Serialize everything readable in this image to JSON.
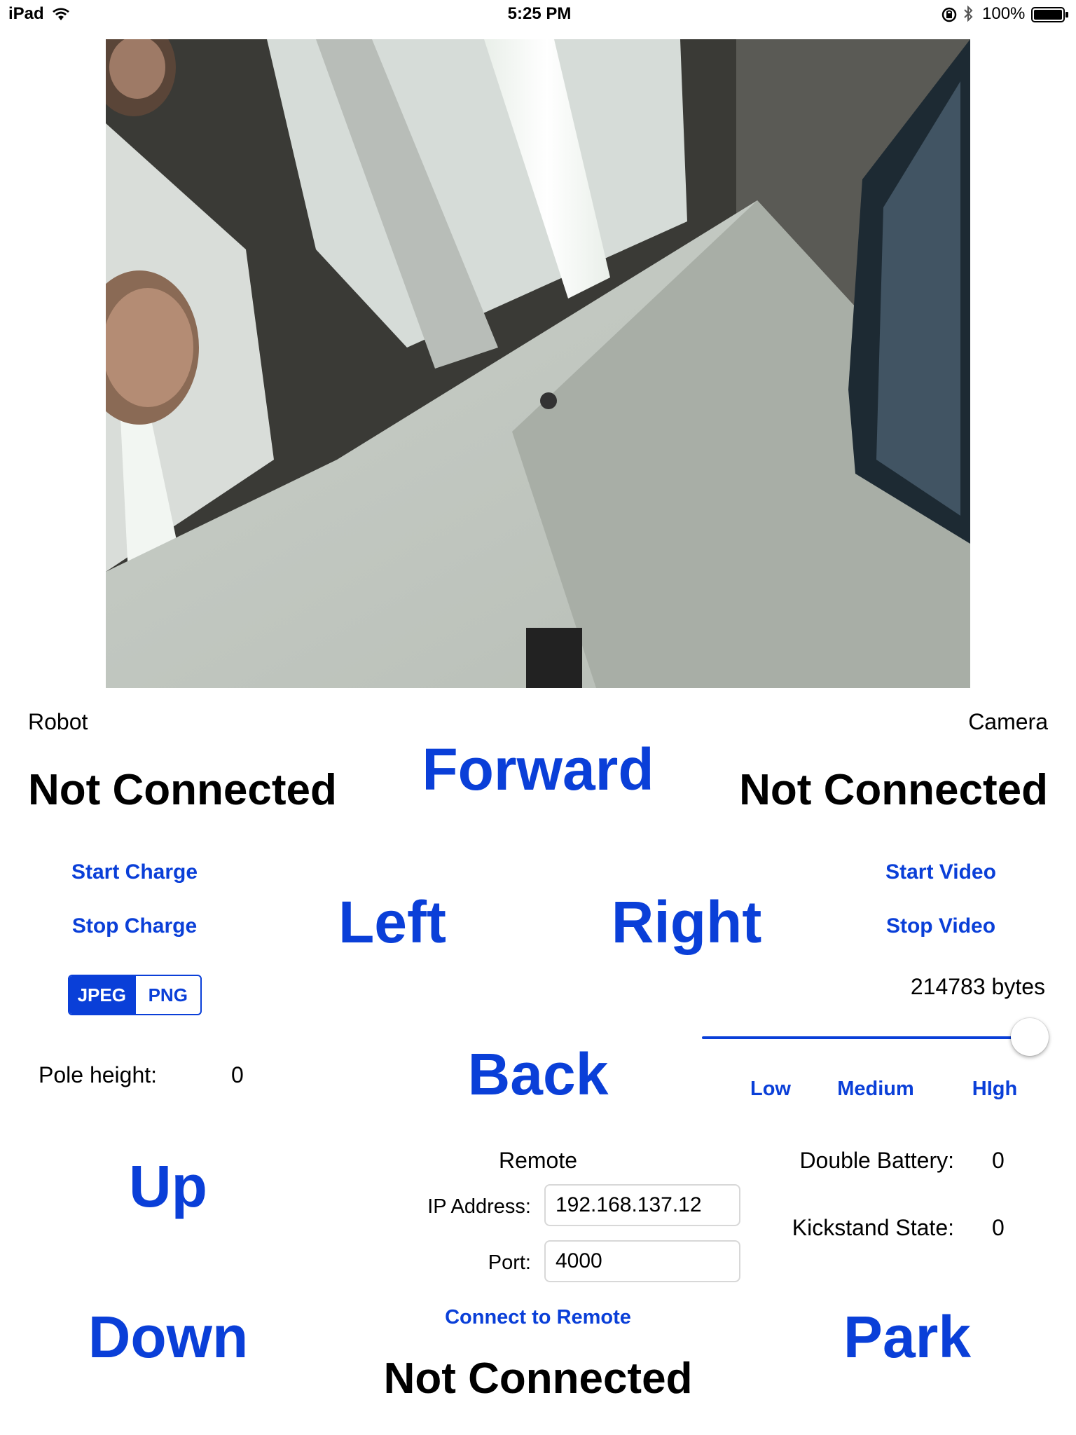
{
  "status_bar": {
    "device": "iPad",
    "time": "5:25 PM",
    "battery": "100%"
  },
  "robot": {
    "title": "Robot",
    "status": "Not Connected",
    "start_charge": "Start Charge",
    "stop_charge": "Stop Charge",
    "format_options": [
      "JPEG",
      "PNG"
    ],
    "format_selected": "JPEG",
    "pole_height_label": "Pole height:",
    "pole_height_value": "0"
  },
  "drive": {
    "forward": "Forward",
    "left": "Left",
    "right": "Right",
    "back": "Back",
    "up": "Up",
    "down": "Down",
    "park": "Park"
  },
  "camera": {
    "title": "Camera",
    "status": "Not Connected",
    "start_video": "Start Video",
    "stop_video": "Stop Video",
    "bytes": "214783 bytes",
    "quality_level": 1.0,
    "quality_options": [
      "Low",
      "Medium",
      "HIgh"
    ]
  },
  "remote": {
    "title": "Remote",
    "ip_label": "IP Address:",
    "ip_value": "192.168.137.12",
    "port_label": "Port:",
    "port_value": "4000",
    "connect": "Connect to Remote",
    "status": "Not Connected"
  },
  "sensors": {
    "double_battery_label": "Double Battery:",
    "double_battery_value": "0",
    "kickstand_label": "Kickstand State:",
    "kickstand_value": "0"
  },
  "colors": {
    "accent": "#0a3fd8",
    "text": "#000000",
    "background": "#ffffff"
  }
}
